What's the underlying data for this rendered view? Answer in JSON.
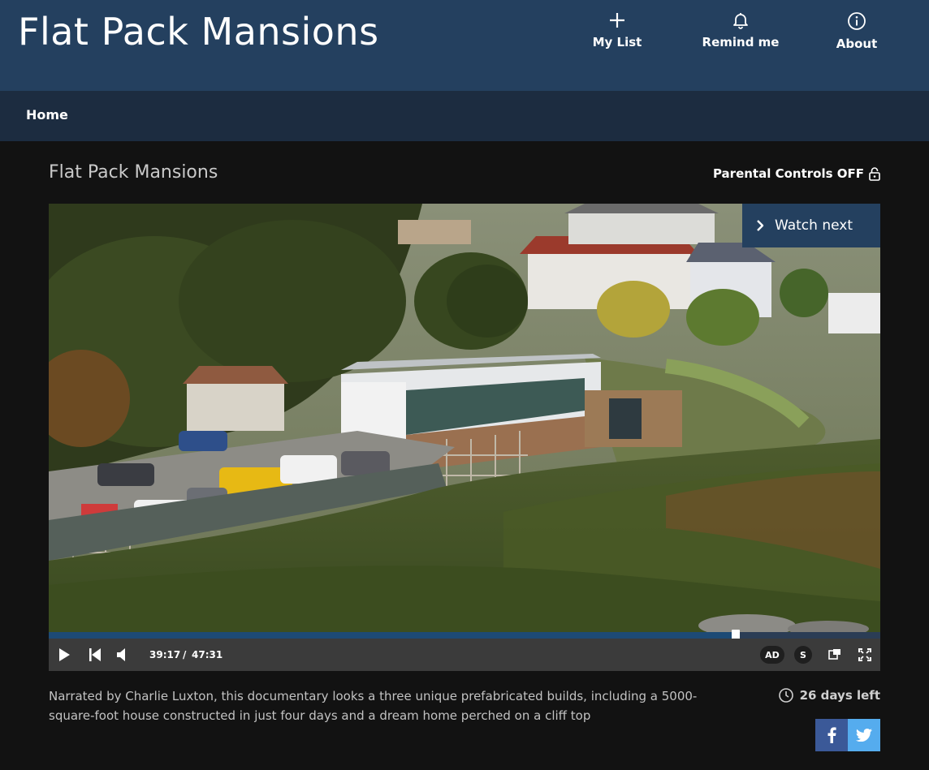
{
  "header": {
    "brand": "Flat Pack Mansions",
    "actions": [
      {
        "label": "My List",
        "icon": "plus-icon"
      },
      {
        "label": "Remind me",
        "icon": "bell-icon"
      },
      {
        "label": "About",
        "icon": "info-icon"
      }
    ]
  },
  "subnav": {
    "home": "Home"
  },
  "program": {
    "title": "Flat Pack Mansions",
    "parental_controls": "Parental Controls OFF",
    "description": "Narrated by Charlie Luxton, this documentary looks a three unique prefabricated builds, including a 5000-square-foot house constructed in just four days and a dream home perched on a cliff top",
    "days_left": "26 days left"
  },
  "player": {
    "watch_next": "Watch next",
    "current_time": "39:17",
    "separator": "/",
    "duration": "47:31",
    "progress_fraction": 0.826,
    "ad_label": "AD",
    "subtitles_label": "S"
  },
  "colors": {
    "header_bg": "#24405f",
    "subnav_bg": "#1c2c40",
    "page_bg": "#121212",
    "facebook": "#3b5998",
    "twitter": "#55acee"
  },
  "icons": [
    "plus-icon",
    "bell-icon",
    "info-icon",
    "lock-icon",
    "chevron-right-icon",
    "play-icon",
    "skip-back-icon",
    "volume-icon",
    "mini-player-icon",
    "fullscreen-icon",
    "clock-icon",
    "facebook-icon",
    "twitter-icon"
  ]
}
